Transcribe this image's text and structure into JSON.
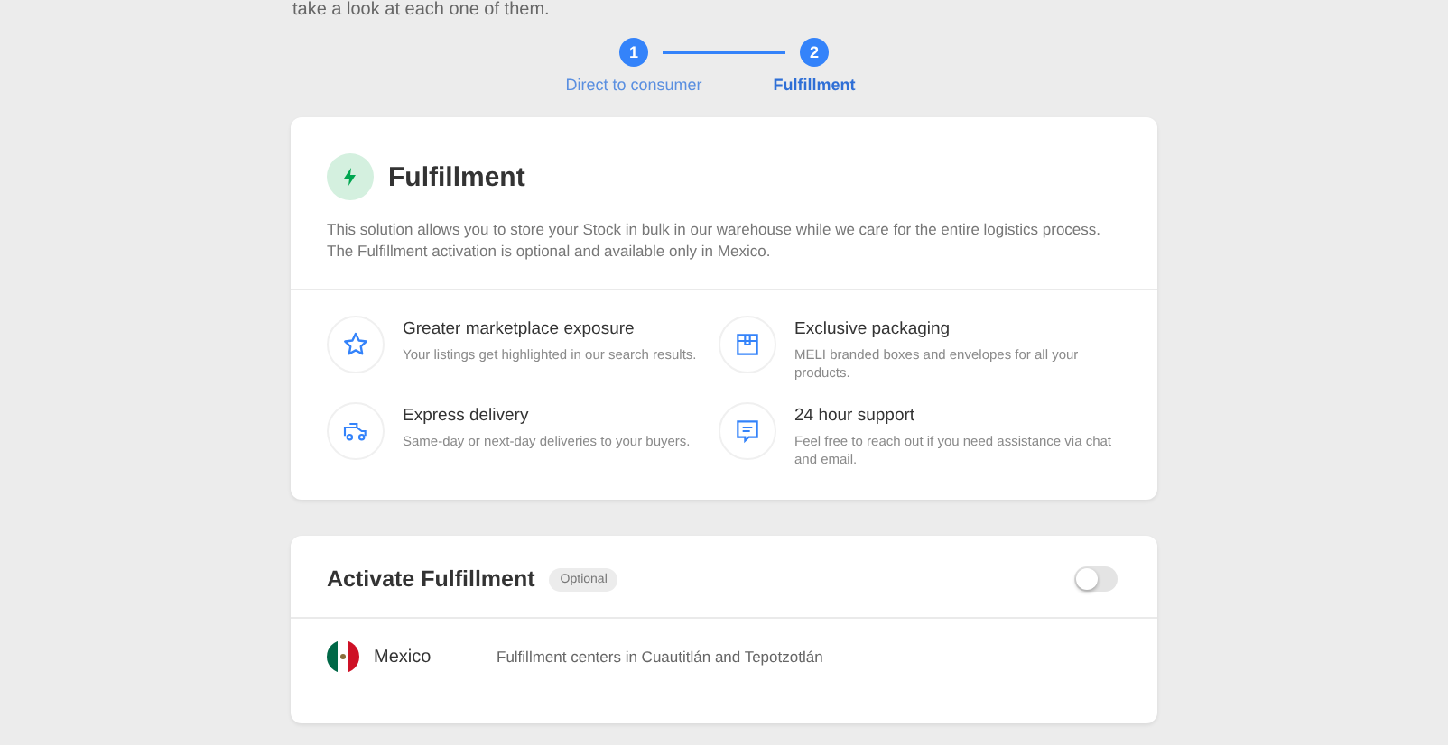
{
  "intro_text": "take a look at each one of them.",
  "steps": [
    {
      "number": "1",
      "label": "Direct to consumer",
      "selected": false
    },
    {
      "number": "2",
      "label": "Fulfillment",
      "selected": true
    }
  ],
  "solution_card": {
    "title": "Fulfillment",
    "description": "This solution allows you to store your Stock in bulk in our warehouse while we care for the entire logistics process. The Fulfillment activation is optional and available only in Mexico.",
    "benefits": [
      {
        "kind": "star",
        "title": "Greater marketplace exposure",
        "text": "Your listings get highlighted in our search results."
      },
      {
        "kind": "box",
        "title": "Exclusive packaging",
        "text": "MELI branded boxes and envelopes for all your products."
      },
      {
        "kind": "truck",
        "title": "Express delivery",
        "text": "Same-day or next-day deliveries to your buyers."
      },
      {
        "kind": "chat",
        "title": "24 hour support",
        "text": "Feel free to reach out if you need assistance via chat and email."
      }
    ]
  },
  "activation_card": {
    "title": "Activate Fulfillment",
    "badge": "Optional",
    "on": false,
    "countries": [
      {
        "name": "Mexico",
        "detail": "Fulfillment centers in Cuautitlán and Tepotzotlán"
      }
    ]
  }
}
